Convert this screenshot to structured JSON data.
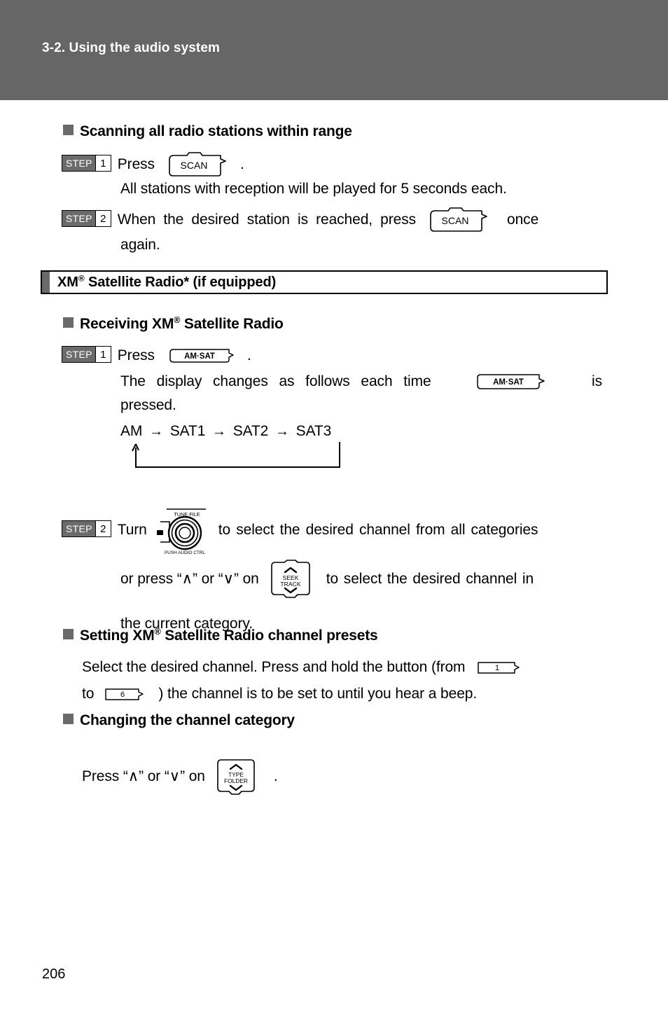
{
  "header": {
    "title": "3-2. Using the audio system"
  },
  "sections": {
    "scanning": {
      "heading": "Scanning all radio stations within range",
      "step1": {
        "step_word": "STEP",
        "step_number": "1",
        "text_before": "Press",
        "button": "SCAN",
        "text_after": "."
      },
      "note": "All stations with reception will be played for 5 seconds each.",
      "step2": {
        "step_word": "STEP",
        "step_number": "2",
        "text_before": "When the desired station is reached, press",
        "button": "SCAN",
        "text_after": "once",
        "text_line2": "again."
      }
    },
    "xm": {
      "title_pre": "XM",
      "title_reg": "®",
      "title_post": " Satellite Radio* (if equipped)",
      "receiving": {
        "heading_pre": "Receiving XM",
        "heading_reg": "®",
        "heading_post": " Satellite Radio",
        "step1": {
          "step_word": "STEP",
          "step_number": "1",
          "text_before": "Press",
          "button": "AM·SAT",
          "text_after": "."
        },
        "display_note_a": "The display changes as follows each time",
        "display_note_button": "AM·SAT",
        "display_note_b": "is",
        "display_note_c": "pressed.",
        "flow": {
          "items": [
            "AM",
            "SAT1",
            "SAT2",
            "SAT3"
          ],
          "arrow": "→"
        },
        "step2": {
          "step_word": "STEP",
          "step_number": "2",
          "text_before": "Turn",
          "knob": {
            "top_label": "TUNE·FILE",
            "bottom_label": "PUSH AUDIO CTRL"
          },
          "text_after": "to select the desired channel from all categories",
          "line2_a": "or press “∧” or “∨” on",
          "line2_button_top": "SEEK",
          "line2_button_bottom": "TRACK",
          "line2_b": "to select the desired channel in",
          "line3": "the current category."
        }
      },
      "presets": {
        "heading_pre": "Setting XM",
        "heading_reg": "®",
        "heading_post": " Satellite Radio channel presets",
        "text_a": "Select the desired channel. Press and hold the button (from",
        "button_from": "1",
        "text_b": "to",
        "button_to": "6",
        "text_c": ") the channel is to be set to until you hear a beep."
      },
      "category": {
        "heading": "Changing the channel category",
        "text_a": "Press “∧” or “∨” on",
        "button_top": "TYPE",
        "button_bottom": "FOLDER",
        "text_b": "."
      }
    }
  },
  "footer": {
    "page_number": "206"
  },
  "colors": {
    "header_band": "#666666",
    "bullet_square": "#6a6a6a",
    "step_badge": "#6b6b6b"
  }
}
